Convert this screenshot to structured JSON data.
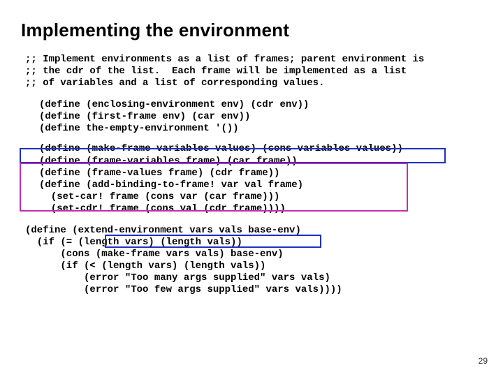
{
  "title": "Implementing the environment",
  "comments": {
    "l1": ";; Implement environments as a list of frames; parent environment is",
    "l2": ";; the cdr of the list.  Each frame will be implemented as a list",
    "l3": ";; of variables and a list of corresponding values."
  },
  "block1": {
    "l1": "(define (enclosing-environment env) (cdr env))",
    "l2": "(define (first-frame env) (car env))",
    "l3": "(define the-empty-environment '())"
  },
  "block2": {
    "l1": "(define (make-frame variables values) (cons variables values))",
    "l2": "(define (frame-variables frame) (car frame))",
    "l3": "(define (frame-values frame) (cdr frame))",
    "l4": "(define (add-binding-to-frame! var val frame)",
    "l5": "  (set-car! frame (cons var (car frame)))",
    "l6": "  (set-cdr! frame (cons val (cdr frame))))"
  },
  "block3": {
    "l1": "(define (extend-environment vars vals base-env)",
    "l2": "  (if (= (length vars) (length vals))",
    "l3": "      (cons (make-frame vars vals) base-env)",
    "l4": "      (if (< (length vars) (length vals))",
    "l5": "          (error \"Too many args supplied\" vars vals)",
    "l6": "          (error \"Too few args supplied\" vars vals))))"
  },
  "page_number": "29"
}
